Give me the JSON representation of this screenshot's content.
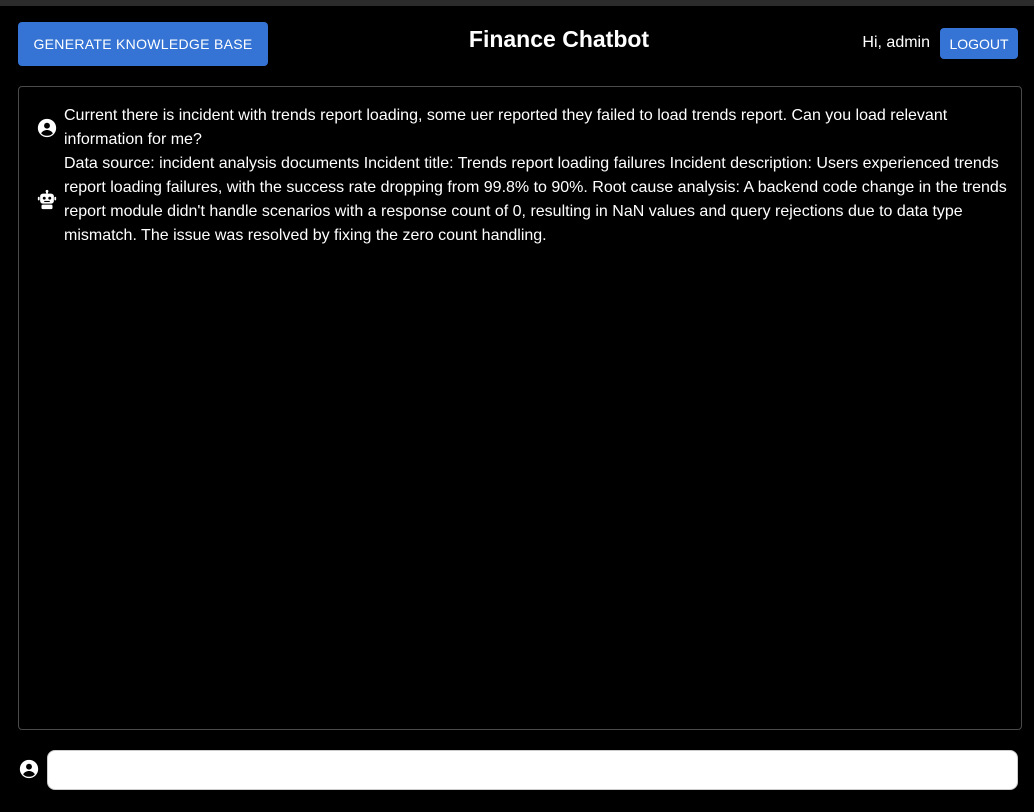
{
  "header": {
    "generate_label": "GENERATE KNOWLEDGE BASE",
    "title": "Finance Chatbot",
    "greeting": "Hi, admin",
    "logout_label": "LOGOUT"
  },
  "messages": [
    {
      "role": "user",
      "icon": "user-avatar-icon",
      "text": "Current there is incident with trends report loading, some uer reported they failed to load trends report. Can you load relevant information for me?"
    },
    {
      "role": "bot",
      "icon": "robot-icon",
      "text": "Data source: incident analysis documents Incident title: Trends report loading failures Incident description: Users experienced trends report loading failures, with the success rate dropping from 99.8% to 90%. Root cause analysis: A backend code change in the trends report module didn't handle scenarios with a response count of 0, resulting in NaN values and query rejections due to data type mismatch. The issue was resolved by fixing the zero count handling."
    }
  ],
  "input": {
    "value": "",
    "placeholder": ""
  },
  "colors": {
    "accent": "#3574d4",
    "background": "#000000"
  }
}
